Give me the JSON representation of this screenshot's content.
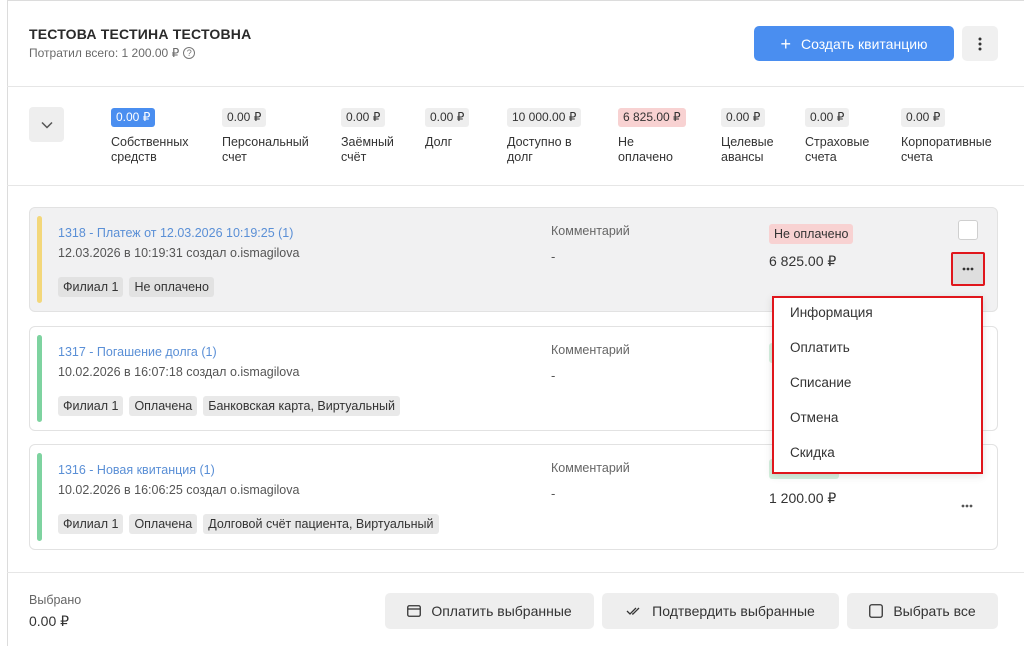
{
  "header": {
    "client_name": "ТЕСТОВА ТЕСТИНА ТЕСТОВНА",
    "spent_total": "Потратил всего: 1 200.00 ₽",
    "create_button": "Создать квитанцию"
  },
  "balances": [
    {
      "amount": "0.00 ₽",
      "label": "Собственных\nсредств",
      "style": "blue"
    },
    {
      "amount": "0.00 ₽",
      "label": "Персональный\nсчет",
      "style": "grey"
    },
    {
      "amount": "0.00 ₽",
      "label": "Заёмный\nсчёт",
      "style": "grey"
    },
    {
      "amount": "0.00 ₽",
      "label": "Долг",
      "style": "grey"
    },
    {
      "amount": "10 000.00 ₽",
      "label": "Доступно в\nдолг",
      "style": "grey"
    },
    {
      "amount": "6 825.00 ₽",
      "label": "Не\nоплачено",
      "style": "red"
    },
    {
      "amount": "0.00 ₽",
      "label": "Целевые\nавансы",
      "style": "grey"
    },
    {
      "amount": "0.00 ₽",
      "label": "Страховые\nсчета",
      "style": "grey"
    },
    {
      "amount": "0.00 ₽",
      "label": "Корпоративные\nсчета",
      "style": "grey"
    }
  ],
  "receipts": [
    {
      "title": "1318 - Платеж от 12.03.2026 10:19:25 (1)",
      "meta": "12.03.2026 в 10:19:31 создал o.ismagilova",
      "tags": [
        "Филиал 1",
        "Не оплачено"
      ],
      "comment_label": "Комментарий",
      "comment": "-",
      "status": "Не оплачено",
      "amount": "6 825.00 ₽",
      "bar_color": "#f3d77a"
    },
    {
      "title": "1317 - Погашение долга (1)",
      "meta": "10.02.2026 в 16:07:18 создал o.ismagilova",
      "tags": [
        "Филиал 1",
        "Оплачена",
        "Банковская карта, Виртуальный"
      ],
      "comment_label": "Комментарий",
      "comment": "-",
      "status": "",
      "amount": "",
      "bar_color": "#7ed3a0"
    },
    {
      "title": "1316 - Новая квитанция (1)",
      "meta": "10.02.2026 в 16:06:25 создал o.ismagilova",
      "tags": [
        "Филиал 1",
        "Оплачена",
        "Долговой счёт пациента, Виртуальный"
      ],
      "comment_label": "Комментарий",
      "comment": "-",
      "status": "",
      "amount": "1 200.00 ₽",
      "bar_color": "#7ed3a0"
    }
  ],
  "menu": {
    "items": [
      "Информация",
      "Оплатить",
      "Списание",
      "Отмена",
      "Скидка"
    ]
  },
  "footer": {
    "selected_label": "Выбрано",
    "selected_value": "0.00 ₽",
    "pay_selected": "Оплатить выбранные",
    "confirm_selected": "Подтвердить выбранные",
    "select_all": "Выбрать все"
  },
  "colors": {
    "accent": "#4a8ef0",
    "highlight_outline": "#e0161c",
    "unpaid_badge": "#f8d2d2",
    "paid_badge": "#d6f1df"
  }
}
